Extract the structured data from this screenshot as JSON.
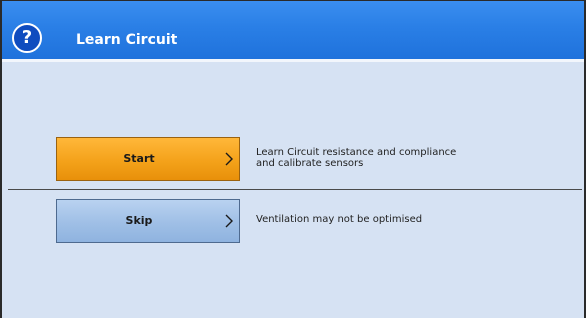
{
  "dialog": {
    "title": "Learn Circuit",
    "help_icon": "question-mark-icon",
    "help_glyph": "?"
  },
  "options": {
    "start": {
      "label": "Start",
      "chevron_icon": "chevron-right-icon",
      "description_line1": "Learn Circuit resistance and compliance",
      "description_line2": "and calibrate sensors",
      "color": "#f4a21a"
    },
    "skip": {
      "label": "Skip",
      "chevron_icon": "chevron-right-icon",
      "description": "Ventilation may not be optimised",
      "color": "#9fbfe6"
    }
  },
  "colors": {
    "titlebar": "#2a7fe6",
    "background": "#d6e2f3"
  }
}
